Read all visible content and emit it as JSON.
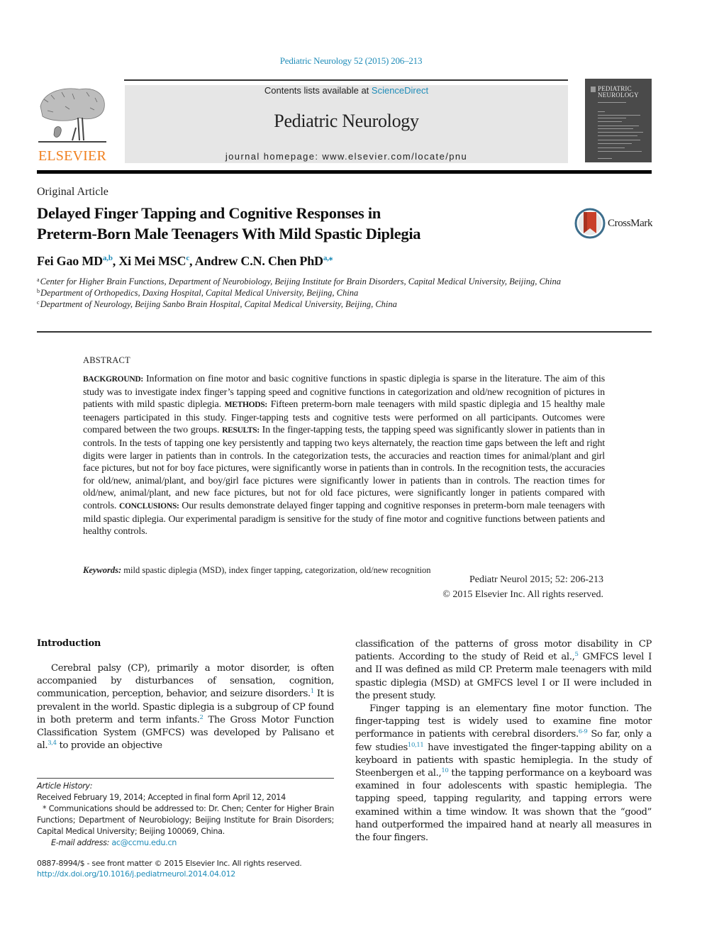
{
  "header": {
    "journal_reference": "Pediatric Neurology 52 (2015) 206–213",
    "contents_prefix": "Contents lists available at ",
    "contents_link": "ScienceDirect",
    "journal_name": "Pediatric Neurology",
    "homepage_prefix": "journal homepage: ",
    "homepage_url": "www.elsevier.com/locate/pnu",
    "publisher_logo_text": "ELSEVIER",
    "cover_title_line1": "PEDIATRIC",
    "cover_title_line2": "NEUROLOGY",
    "colors": {
      "link": "#1f8cb8",
      "publisher_orange": "#f07f1d",
      "banner_bg": "#e6e6e6",
      "cover_bg": "#4a4a4a"
    }
  },
  "article": {
    "type": "Original Article",
    "title_line1": "Delayed Finger Tapping and Cognitive Responses in",
    "title_line2": "Preterm-Born Male Teenagers With Mild Spastic Diplegia",
    "crossmark_label": "CrossMark",
    "authors": [
      {
        "name": "Fei Gao MD",
        "affil": "a,b",
        "sep": ", "
      },
      {
        "name": "Xi Mei  MSC",
        "affil": "c",
        "sep": ", "
      },
      {
        "name": "Andrew C.N. Chen PhD",
        "affil": "a,⁎",
        "sep": ""
      }
    ],
    "affiliations": [
      {
        "key": "a",
        "text": "Center for Higher Brain Functions, Department of Neurobiology, Beijing Institute for Brain Disorders, Capital Medical University, Beijing, China"
      },
      {
        "key": "b",
        "text": "Department of Orthopedics, Daxing Hospital, Capital Medical University, Beijing, China"
      },
      {
        "key": "c",
        "text": "Department of Neurology, Beijing Sanbo Brain Hospital, Capital Medical University, Beijing, China"
      }
    ]
  },
  "abstract": {
    "heading": "ABSTRACT",
    "background_label": "BACKGROUND:",
    "background_text": " Information on fine motor and basic cognitive functions in spastic diplegia is sparse in the literature. The aim of this study was to investigate index finger’s tapping speed and cognitive functions in categorization and old/new recognition of pictures in patients with mild spastic diplegia. ",
    "methods_label": "METHODS:",
    "methods_text": " Fifteen preterm-born male teenagers with mild spastic diplegia and 15 healthy male teenagers participated in this study. Finger-tapping tests and cognitive tests were performed on all participants. Outcomes were compared between the two groups. ",
    "results_label": "RESULTS:",
    "results_text": " In the finger-tapping tests, the tapping speed was significantly slower in patients than in controls. In the tests of tapping one key persistently and tapping two keys alternately, the reaction time gaps between the left and right digits were larger in patients than in controls. In the categorization tests, the accuracies and reaction times for animal/plant and girl face pictures, but not for boy face pictures, were significantly worse in patients than in controls. In the recognition tests, the accuracies for old/new, animal/plant, and boy/girl face pictures were significantly lower in patients than in controls. The reaction times for old/new, animal/plant, and new face pictures, but not for old face pictures, were significantly longer in patients compared with controls. ",
    "conclusions_label": "CONCLUSIONS:",
    "conclusions_text": " Our results demonstrate delayed finger tapping and cognitive responses in preterm-born male teenagers with mild spastic diplegia. Our experimental paradigm is sensitive for the study of fine motor and cognitive functions between patients and healthy controls.",
    "keywords_label": "Keywords:",
    "keywords_text": " mild spastic diplegia (MSD), index finger tapping, categorization, old/new recognition",
    "citation": "Pediatr Neurol 2015; 52: 206-213",
    "copyright": "© 2015 Elsevier Inc. All rights reserved."
  },
  "body": {
    "intro_heading": "Introduction",
    "left_p1": [
      "Cerebral palsy (CP), primarily a motor disorder, is often accompanied by disturbances of sensation, cognition, communication, perception, behavior, and seizure disorders.",
      "1",
      " It is prevalent in the world. Spastic diplegia is a subgroup of CP found in both preterm and term infants.",
      "2",
      " The Gross Motor Function Classification System (GMFCS) was developed by Palisano et al.",
      "3,4",
      " to provide an objective"
    ],
    "right_p1": [
      "classification of the patterns of gross motor disability in CP patients. According to the study of Reid et al.,",
      "5",
      " GMFCS level I and II was defined as mild CP. Preterm male teenagers with mild spastic diplegia (MSD) at GMFCS level I or II were included in the present study."
    ],
    "right_p2": [
      "Finger tapping is an elementary fine motor function. The finger-tapping test is widely used to examine fine motor performance in patients with cerebral disorders.",
      "6-9",
      " So far, only a few studies",
      "10,11",
      " have investigated the finger-tapping ability on a keyboard in patients with spastic hemiplegia. In the study of Steenbergen et al.,",
      "10",
      " the tapping performance on a keyboard was examined in four adolescents with spastic hemiplegia. The tapping speed, tapping regularity, and tapping errors were examined within a time window. It was shown that the “good” hand outperformed the impaired hand at nearly all measures in the four fingers."
    ]
  },
  "footnotes": {
    "history_label": "Article History:",
    "history_text": "Received February 19, 2014; Accepted in final form April 12, 2014",
    "correspondence": "* Communications should be addressed to: Dr. Chen; Center for Higher Brain Functions; Department of Neurobiology; Beijing Institute for Brain Disorders; Capital Medical University; Beijing 100069, China.",
    "email_label": "E-mail address:",
    "email": "ac@ccmu.edu.cn",
    "issn_line": "0887-8994/$ - see front matter © 2015 Elsevier Inc. All rights reserved.",
    "doi": "http://dx.doi.org/10.1016/j.pediatrneurol.2014.04.012"
  }
}
